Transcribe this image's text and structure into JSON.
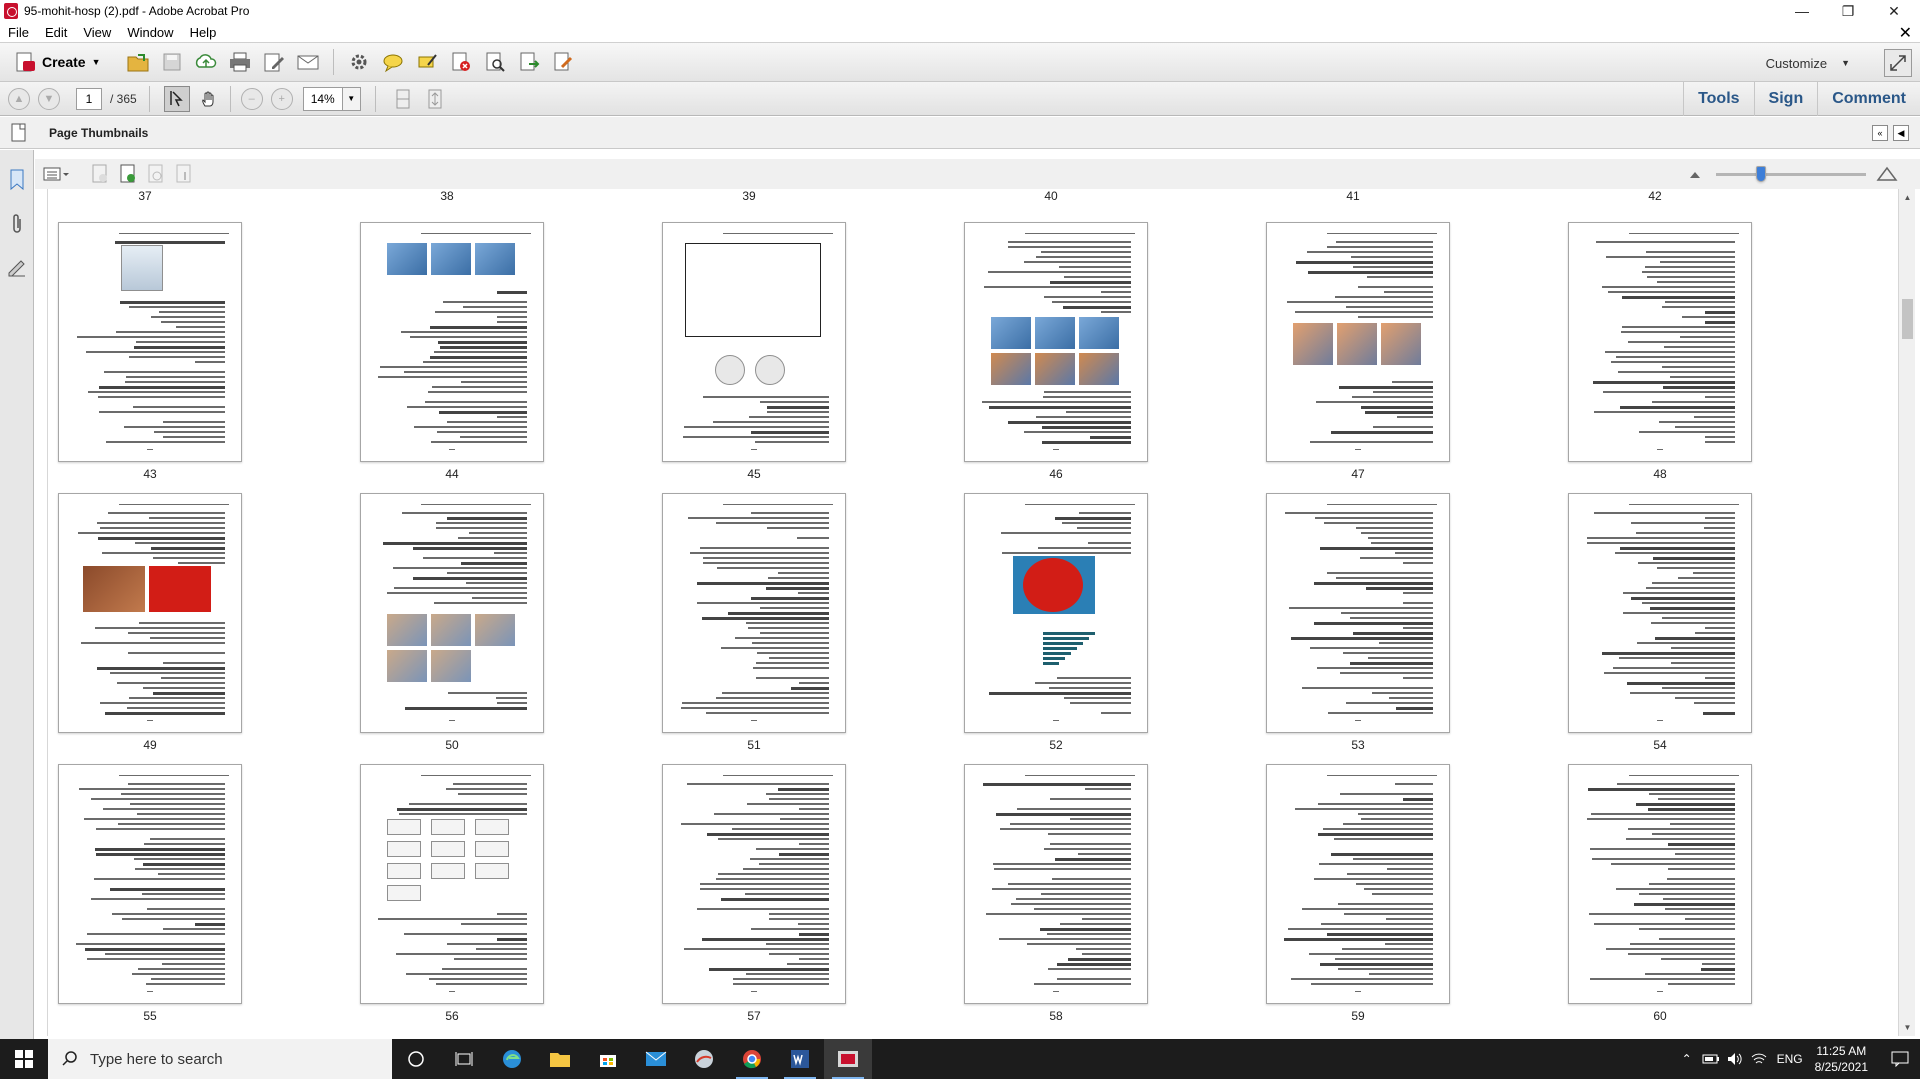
{
  "window": {
    "title": "95-mohit-hosp (2).pdf - Adobe Acrobat Pro"
  },
  "menu": [
    "File",
    "Edit",
    "View",
    "Window",
    "Help"
  ],
  "toolbar": {
    "create_label": "Create",
    "customize_label": "Customize",
    "icons": [
      "open-icon",
      "save-icon",
      "upload-icon",
      "print-icon",
      "edit-icon",
      "email-icon",
      "gear-icon",
      "comment-icon",
      "highlight-icon",
      "delete-icon",
      "search-doc-icon",
      "export-icon",
      "form-icon"
    ]
  },
  "nav": {
    "current_page": "1",
    "total_pages": "/ 365",
    "zoom": "14%"
  },
  "right_tabs": [
    "Tools",
    "Sign",
    "Comment"
  ],
  "panel": {
    "title": "Page Thumbnails"
  },
  "thumbnails": {
    "top_labels": [
      "37",
      "38",
      "39",
      "40",
      "41",
      "42"
    ],
    "rows": [
      [
        "43",
        "44",
        "45",
        "46",
        "47",
        "48"
      ],
      [
        "49",
        "50",
        "51",
        "52",
        "53",
        "54"
      ],
      [
        "55",
        "56",
        "57",
        "58",
        "59",
        "60"
      ]
    ]
  },
  "taskbar": {
    "search_placeholder": "Type here to search",
    "language": "ENG",
    "time": "11:25 AM",
    "date": "8/25/2021"
  },
  "colors": {
    "accent_blue": "#2a5788",
    "taskbar": "#1c1c1c",
    "slider_thumb": "#3d7ed8"
  }
}
